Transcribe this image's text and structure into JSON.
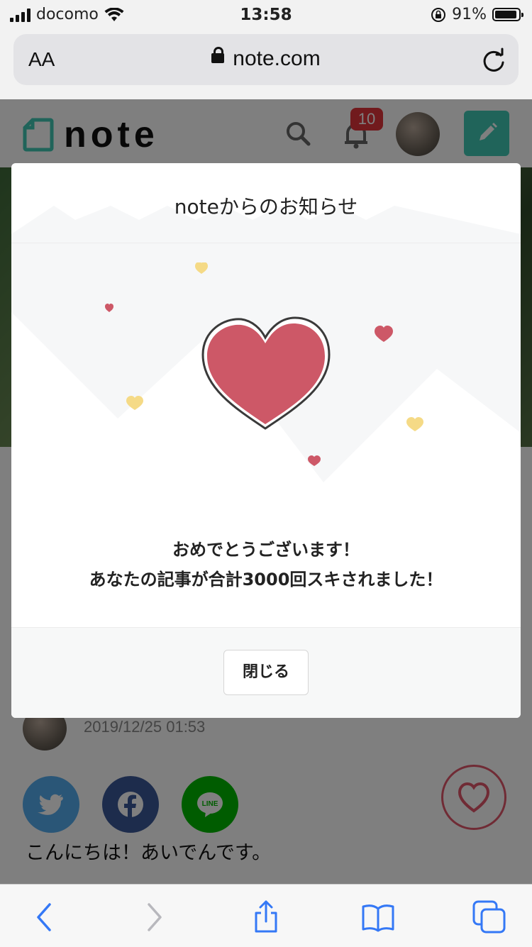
{
  "status_bar": {
    "carrier": "docomo",
    "time": "13:58",
    "battery": "91%"
  },
  "browser": {
    "text_size_label": "AA",
    "url": "note.com"
  },
  "header": {
    "logo": "note",
    "notification_count": "10"
  },
  "post": {
    "date": "2019/12/25 01:53",
    "share_line_label": "LINE",
    "intro": "こんにちは！あいでんです。"
  },
  "modal": {
    "title": "noteからのお知らせ",
    "message_line1": "おめでとうございます！",
    "message_line2": "あなたの記事が合計3000回スキされました！",
    "close_label": "閉じる"
  },
  "colors": {
    "heart": "#cd5867",
    "small_heart_yellow": "#f5da86",
    "accent": "#41c9b4"
  }
}
